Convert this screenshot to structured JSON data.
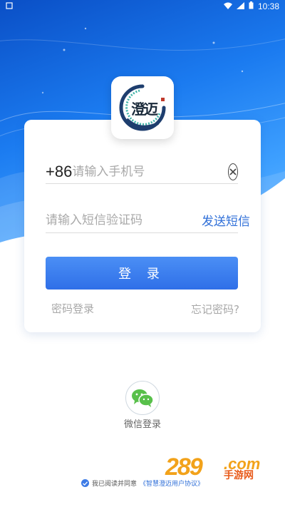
{
  "status": {
    "time": "10:38"
  },
  "logo": {
    "text": "澄迈"
  },
  "login": {
    "country_code": "+86",
    "phone_placeholder": "请输入手机号",
    "sms_placeholder": "请输入短信验证码",
    "send_sms_label": "发送短信",
    "login_button": "登 录",
    "password_login_link": "密码登录",
    "forgot_password_link": "忘记密码?"
  },
  "social": {
    "wechat_label": "微信登录"
  },
  "agreement": {
    "prefix": "我已阅读并同意",
    "link": "《智慧澄迈用户协议》"
  },
  "watermark": {
    "number": "289",
    "domain": ".com",
    "text": "手游网"
  },
  "colors": {
    "accent": "#2f6fd8",
    "wechat_green": "#58c04a",
    "watermark_orange": "#f2a21a"
  }
}
